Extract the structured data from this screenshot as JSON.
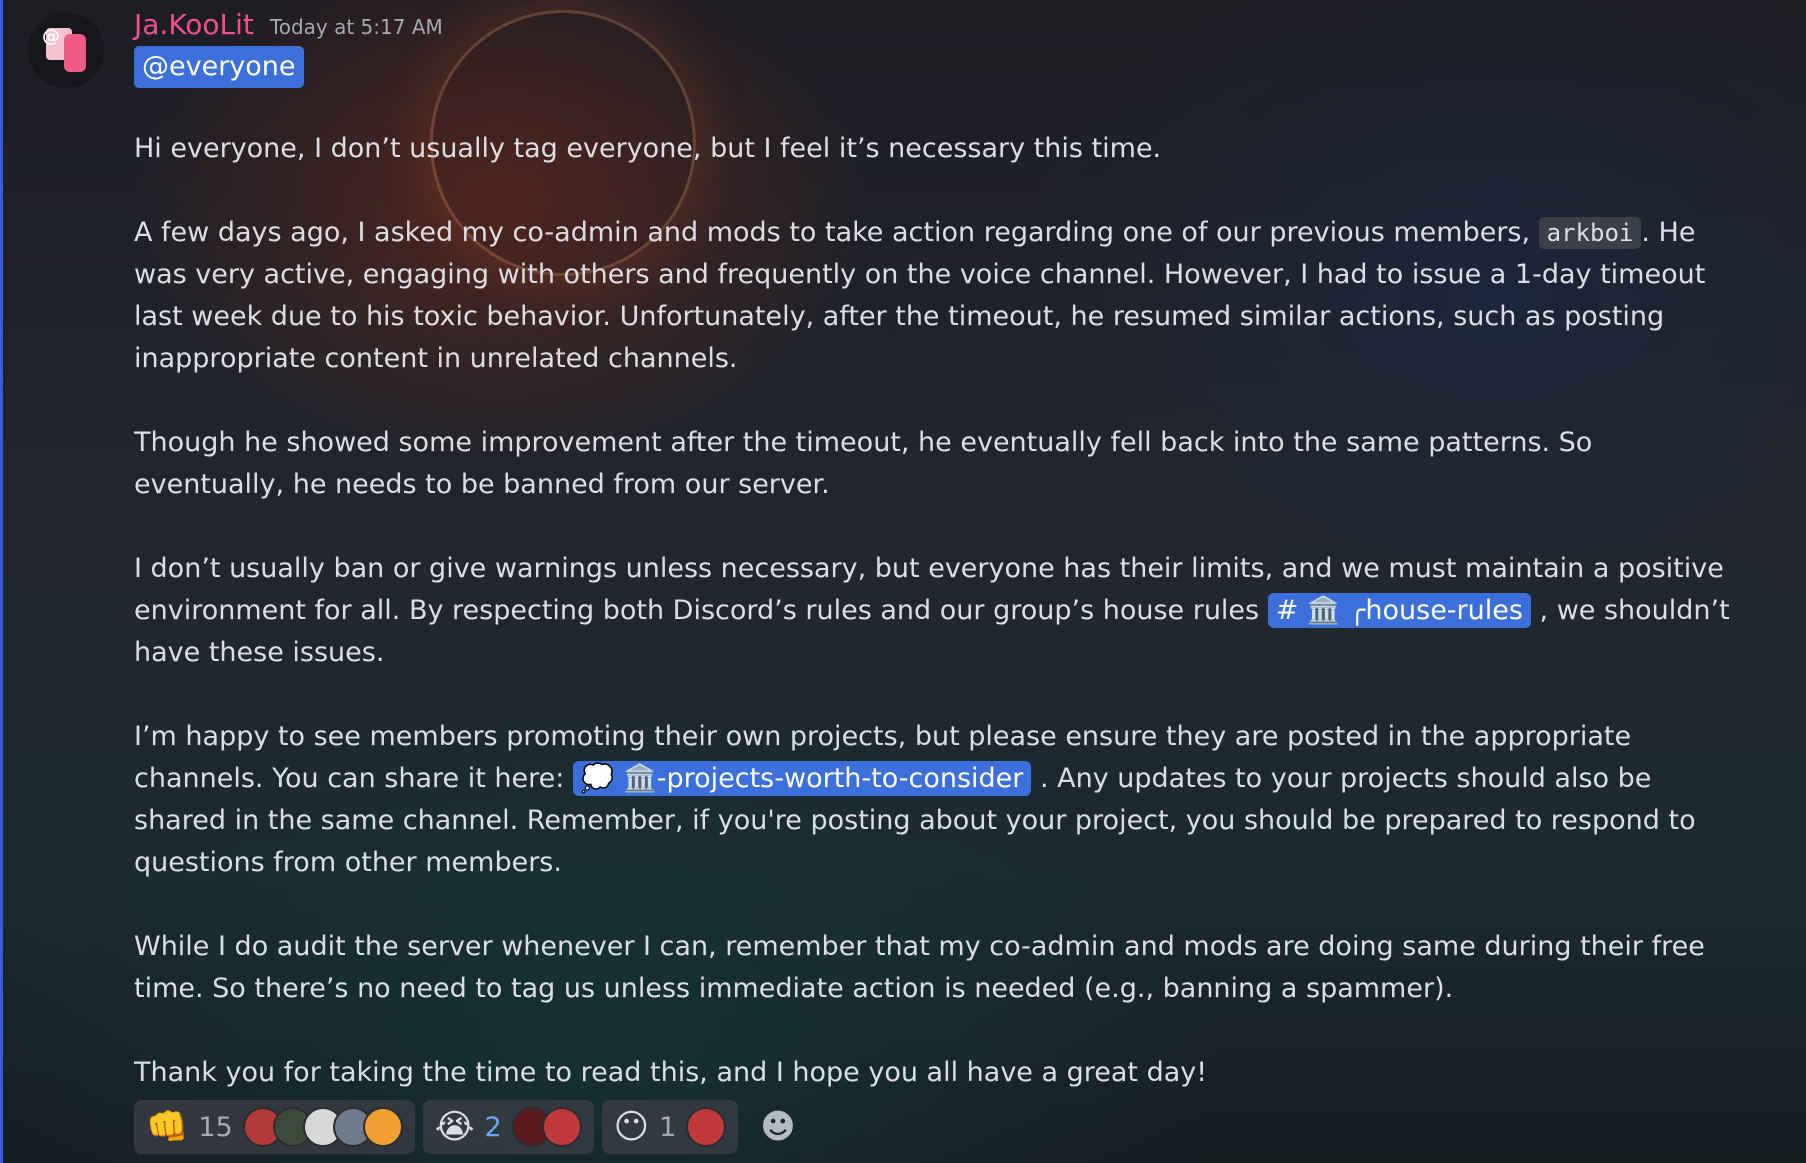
{
  "message": {
    "username": "Ja.KooLit",
    "timestamp": "Today at 5:17 AM",
    "mention": "@everyone",
    "p1": "Hi everyone, I don’t usually tag everyone, but I feel it’s necessary this time.",
    "p2_before": "A few days ago, I asked my co-admin and mods to take action regarding one of our previous members,",
    "p2_code": "arkboi",
    "p2_after": ". He was very active, engaging with others and frequently on the voice channel. However, I had to issue a 1-day timeout last week due to his toxic behavior. Unfortunately, after the timeout, he resumed similar actions, such as posting inappropriate content in unrelated channels.",
    "p3": "Though he showed some improvement after the timeout, he eventually fell back into the same patterns. So eventually, he needs to be banned from our server.",
    "p4_before": "I don’t usually ban or give warnings unless necessary, but everyone has their limits, and we must maintain a positive environment for all. By respecting both Discord’s rules and our group’s house rules",
    "p4_channel": "# 🏛️ ╭house-rules",
    "p4_after": ", we shouldn’t have these issues.",
    "p5_before": "I’m happy to see members promoting their own projects, but please ensure they are posted in the appropriate channels. You can share it here:",
    "p5_channel": "💭 🏛️-projects-worth-to-consider",
    "p5_after": ". Any updates to your projects should also be shared in the same channel. Remember, if you're posting about your project, you should be prepared to respond to questions from other members.",
    "p6": "While I do audit the server whenever I can, remember that my co-admin and mods are doing same during their free time. So there’s no need to tag us unless immediate action is needed (e.g., banning a spammer).",
    "p7": "Thank you for taking the time to read this, and I hope you all have a great day!"
  },
  "reactions": [
    {
      "emoji": "👊",
      "count": "15"
    },
    {
      "emoji": "😭",
      "count": "2"
    },
    {
      "emoji": "😶",
      "count": "1"
    }
  ],
  "add_reaction_icon": "add-reaction-icon",
  "colors": {
    "username": "#f0508c",
    "mention_bg": "#3c6fd9",
    "accent_bar": "#3b5bdb"
  }
}
